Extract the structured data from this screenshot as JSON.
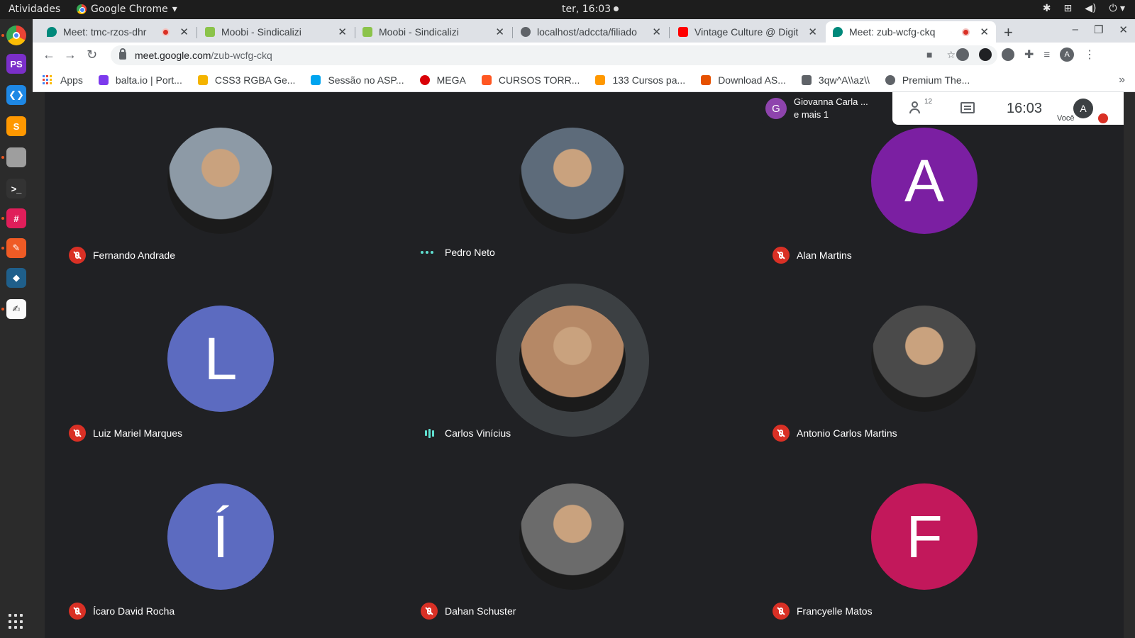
{
  "topbar": {
    "activities": "Atividades",
    "app_name": "Google Chrome",
    "clock": "ter, 16:03"
  },
  "dock": {
    "items": [
      {
        "name": "chrome-icon",
        "color": "#4285f4",
        "glyph": ""
      },
      {
        "name": "phpstorm-icon",
        "color": "#7b2fc9",
        "glyph": "PS"
      },
      {
        "name": "vscode-icon",
        "color": "#1e88e5",
        "glyph": "❮❯"
      },
      {
        "name": "sublime-icon",
        "color": "#ff9800",
        "glyph": "S"
      },
      {
        "name": "files-icon",
        "color": "#9e9e9e",
        "glyph": ""
      },
      {
        "name": "terminal-icon",
        "color": "#333333",
        "glyph": ">_"
      },
      {
        "name": "slack-icon",
        "color": "#e01e5a",
        "glyph": "#"
      },
      {
        "name": "postman-icon",
        "color": "#ef5b25",
        "glyph": "✎"
      },
      {
        "name": "mysql-workbench-icon",
        "color": "#1f5f8b",
        "glyph": "◆"
      },
      {
        "name": "text-editor-icon",
        "color": "#fafafa",
        "glyph": "✍"
      }
    ]
  },
  "tabs": [
    {
      "title": "Meet: tmc-rzos-dhr",
      "favicon": "#00897b",
      "recording": true
    },
    {
      "title": "Moobi - Sindicalizi",
      "favicon": "#8bc34a",
      "recording": false
    },
    {
      "title": "Moobi - Sindicalizi",
      "favicon": "#8bc34a",
      "recording": false
    },
    {
      "title": "localhost/adccta/filiado",
      "favicon": "#5f6368",
      "recording": false
    },
    {
      "title": "Vintage Culture @ Digit",
      "favicon": "#ff0000",
      "recording": false
    },
    {
      "title": "Meet: zub-wcfg-ckq",
      "favicon": "#00897b",
      "recording": true
    }
  ],
  "address": {
    "host": "meet.google.com",
    "path": "/zub-wcfg-ckq"
  },
  "profile_initial": "A",
  "bookmarks": [
    {
      "label": "Apps",
      "icon": "apps-grid-icon",
      "color": "#4285f4"
    },
    {
      "label": "balta.io | Port...",
      "icon": "balta-icon",
      "color": "#7c3aed"
    },
    {
      "label": "CSS3 RGBA Ge...",
      "icon": "css-icon",
      "color": "#f4b400"
    },
    {
      "label": "Sessão no ASP...",
      "icon": "microsoft-icon",
      "color": "#00a4ef"
    },
    {
      "label": "MEGA",
      "icon": "mega-icon",
      "color": "#d90007"
    },
    {
      "label": "CURSOS TORR...",
      "icon": "blogger-icon",
      "color": "#ff5722"
    },
    {
      "label": "133 Cursos pa...",
      "icon": "cursos-icon",
      "color": "#ff9800"
    },
    {
      "label": "Download AS...",
      "icon": "download-icon",
      "color": "#e65100"
    },
    {
      "label": "3qw^A\\\\az\\\\",
      "icon": "folder-icon",
      "color": "#5f6368"
    },
    {
      "label": "Premium The...",
      "icon": "globe-icon",
      "color": "#5f6368"
    }
  ],
  "meet": {
    "presenting_initial": "G",
    "presenting_name": "Giovanna Carla ...",
    "presenting_more": "e mais 1",
    "people_count": "12",
    "time": "16:03",
    "you_label": "Você",
    "you_initial": "A",
    "participants": [
      {
        "name": "Fernando Andrade",
        "status": "muted",
        "kind": "photo",
        "color": "#8d9aa6"
      },
      {
        "name": "Pedro Neto",
        "status": "idle",
        "kind": "photo",
        "color": "#5d6b7a"
      },
      {
        "name": "Alan Martins",
        "status": "muted",
        "kind": "letter",
        "letter": "A",
        "color": "#7b1fa2"
      },
      {
        "name": "Luiz Mariel Marques",
        "status": "muted",
        "kind": "letter",
        "letter": "L",
        "color": "#5c6bc0"
      },
      {
        "name": "Carlos Vinícius",
        "status": "speaking",
        "kind": "photo",
        "color": "#b58866"
      },
      {
        "name": "Antonio Carlos Martins",
        "status": "muted",
        "kind": "photo",
        "color": "#4a4a4a"
      },
      {
        "name": "Ícaro David Rocha",
        "status": "muted",
        "kind": "letter",
        "letter": "Í",
        "color": "#5c6bc0"
      },
      {
        "name": "Dahan Schuster",
        "status": "muted",
        "kind": "photo",
        "color": "#6b6b6b"
      },
      {
        "name": "Francyelle Matos",
        "status": "muted",
        "kind": "letter",
        "letter": "F",
        "color": "#c2185b"
      }
    ]
  }
}
